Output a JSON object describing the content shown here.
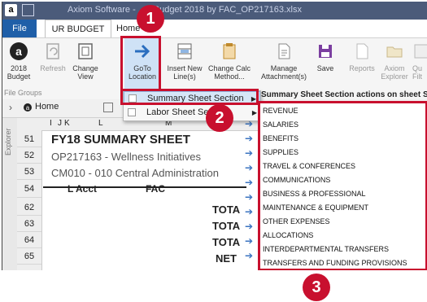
{
  "window": {
    "title": "Axiom Software - ... - Budget 2018 by FAC_OP217163.xlsx",
    "app_icon": "a"
  },
  "tabs": {
    "file": "File",
    "ur_budget": "UR BUDGET",
    "home": "Home"
  },
  "ribbon": {
    "budget_label": "2018\nBudget",
    "refresh": "Refresh",
    "change_view": "Change\nView",
    "goto_location": "GoTo\nLocation",
    "insert_new_lines": "Insert New\nLine(s)",
    "change_calc_method": "Change Calc\nMethod...",
    "manage_attachments": "Manage\nAttachment(s)",
    "save": "Save",
    "reports": "Reports",
    "axiom_explorer": "Axiom\nExplorer",
    "filter": "Qu\nFilt",
    "groups_label": "File Groups"
  },
  "nav": {
    "home_tab": "Home"
  },
  "goto_menu": {
    "items": [
      {
        "label": "Summary Sheet Section"
      },
      {
        "label": "Labor Sheet Section"
      }
    ]
  },
  "submenu": {
    "header": "Summary Sheet Section actions on sheet SUMMARY",
    "items": [
      "REVENUE",
      "SALARIES",
      "BENEFITS",
      "SUPPLIES",
      "TRAVEL & CONFERENCES",
      "COMMUNICATIONS",
      "BUSINESS & PROFESSIONAL",
      "MAINTENANCE & EQUIPMENT",
      "OTHER EXPENSES",
      "ALLOCATIONS",
      "INTERDEPARTMENTAL TRANSFERS",
      "TRANSFERS AND FUNDING PROVISIONS"
    ]
  },
  "sheet": {
    "explorer_label": "Explorer",
    "columns": [
      "I",
      "J",
      "K",
      "L",
      "M"
    ],
    "rows": [
      "51",
      "52",
      "53",
      "54",
      "62",
      "63",
      "64",
      "65"
    ],
    "title": "FY18 SUMMARY SHEET",
    "subtitle": "OP217163 - Wellness Initiatives",
    "department": "CM010 - 010 Central Administration",
    "col_l_acct": "L Acct",
    "col_fac": "FAC",
    "totals": [
      "TOTA",
      "TOTA",
      "TOTA",
      "NET"
    ]
  },
  "callouts": [
    "1",
    "2",
    "3"
  ],
  "colors": {
    "accent": "#1f5fa8",
    "callout_red": "#c8102e",
    "arrow_blue": "#3a73c0"
  }
}
